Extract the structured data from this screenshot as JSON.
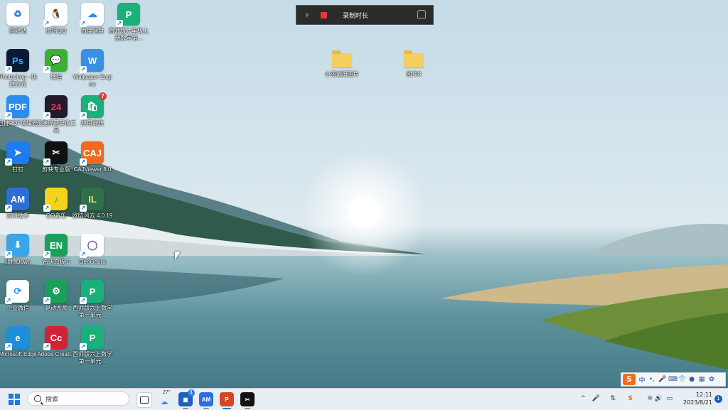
{
  "recording_bar": {
    "title": "录制时长"
  },
  "desktop_icons": [
    {
      "id": "recycle-bin",
      "label": "回收站",
      "glyph": "♻",
      "color": "#ffffff",
      "fg": "#2e7bd6"
    },
    {
      "id": "qq",
      "label": "腾讯QQ",
      "glyph": "🐧",
      "color": "#ffffff",
      "fg": "#000000"
    },
    {
      "id": "baidu-netdisk",
      "label": "百度网盘",
      "glyph": "☁",
      "color": "#ffffff",
      "fg": "#2c8df5"
    },
    {
      "id": "pdf-editor-1",
      "label": "西师版六年级上册数学第...",
      "glyph": "P",
      "color": "#19b07a",
      "fg": "#ffffff"
    },
    {
      "id": "photoshop",
      "label": "Photoshop - 快捷方式",
      "glyph": "Ps",
      "color": "#0a1a35",
      "fg": "#31a8ff"
    },
    {
      "id": "wechat",
      "label": "微信",
      "glyph": "💬",
      "color": "#3cb034",
      "fg": "#ffffff"
    },
    {
      "id": "wallpaper",
      "label": "Wallpaper Engine",
      "glyph": "W",
      "color": "#3a8fe3",
      "fg": "#ffffff"
    },
    {
      "id": "pdf-reader",
      "label": "迅捷PDF编辑器",
      "glyph": "PDF",
      "color": "#2b8cf0",
      "fg": "#ffffff"
    },
    {
      "id": "screen-recorder",
      "label": "迅捷屏幕录像工具",
      "glyph": "24",
      "color": "#241a2e",
      "fg": "#e03a5b"
    },
    {
      "id": "app-store",
      "label": "应用商店",
      "glyph": "🛍",
      "color": "#19b07a",
      "fg": "#ffffff",
      "badge": "7"
    },
    {
      "id": "dingtalk",
      "label": "钉钉",
      "glyph": "➤",
      "color": "#1d7cf2",
      "fg": "#ffffff"
    },
    {
      "id": "capcut",
      "label": "剪映专业版",
      "glyph": "✂",
      "color": "#111111",
      "fg": "#ffffff"
    },
    {
      "id": "caj-viewer",
      "label": "CAJViewer 8.0",
      "glyph": "CAJ",
      "color": "#f06a1e",
      "fg": "#ffffff"
    },
    {
      "id": "am",
      "label": "云帆助手",
      "glyph": "AM",
      "color": "#2d6fd8",
      "fg": "#ffffff"
    },
    {
      "id": "qq-music",
      "label": "QQ音乐",
      "glyph": "♪",
      "color": "#f5d21c",
      "fg": "#1aa05b"
    },
    {
      "id": "game",
      "label": "欧陆风云 4.0.19",
      "glyph": "IL",
      "color": "#2f6f4a",
      "fg": "#f5e06a"
    },
    {
      "id": "bitdown",
      "label": "比特Down",
      "glyph": "⬇",
      "color": "#3aa5e8",
      "fg": "#ffffff"
    },
    {
      "id": "en-app",
      "label": "希沃白板 5",
      "glyph": "EN",
      "color": "#1aa05b",
      "fg": "#ffffff"
    },
    {
      "id": "geogebra",
      "label": "GeoGebra",
      "glyph": "◯",
      "color": "#ffffff",
      "fg": "#6754a5"
    },
    {
      "id": "enterprise-wechat",
      "label": "企业微信",
      "glyph": "⟳",
      "color": "#ffffff",
      "fg": "#2b8cf0"
    },
    {
      "id": "driver",
      "label": "驱动大师",
      "glyph": "⚙",
      "color": "#1aa05b",
      "fg": "#ffffff"
    },
    {
      "id": "pdf-editor-2",
      "label": "西师版六上数学第一单元...",
      "glyph": "P",
      "color": "#19b07a",
      "fg": "#ffffff"
    },
    {
      "id": "edge",
      "label": "Microsoft Edge",
      "glyph": "e",
      "color": "#1f8fdc",
      "fg": "#ffffff"
    },
    {
      "id": "adobe",
      "label": "Adobe Creati...",
      "glyph": "Cc",
      "color": "#d4213a",
      "fg": "#ffffff"
    },
    {
      "id": "pdf-editor-3",
      "label": "西师版六上数学第一单元...",
      "glyph": "P",
      "color": "#19b07a",
      "fg": "#ffffff"
    }
  ],
  "folders": [
    {
      "label": "小图或旧图片"
    },
    {
      "label": "附件8"
    }
  ],
  "ime": {
    "logo": "S",
    "mode": "中",
    "items": [
      "•,",
      "🎤",
      "⌨",
      "👕",
      "●",
      "▦",
      "✿"
    ]
  },
  "taskbar": {
    "search_placeholder": "搜索",
    "weather": "27°",
    "apps_badge": "1",
    "tray_icons": [
      "^",
      "🎤",
      "⇅",
      "S",
      "≋",
      "🔊",
      "▭"
    ],
    "time": "12:11",
    "date": "2023/8/21",
    "notification_count": "1"
  }
}
